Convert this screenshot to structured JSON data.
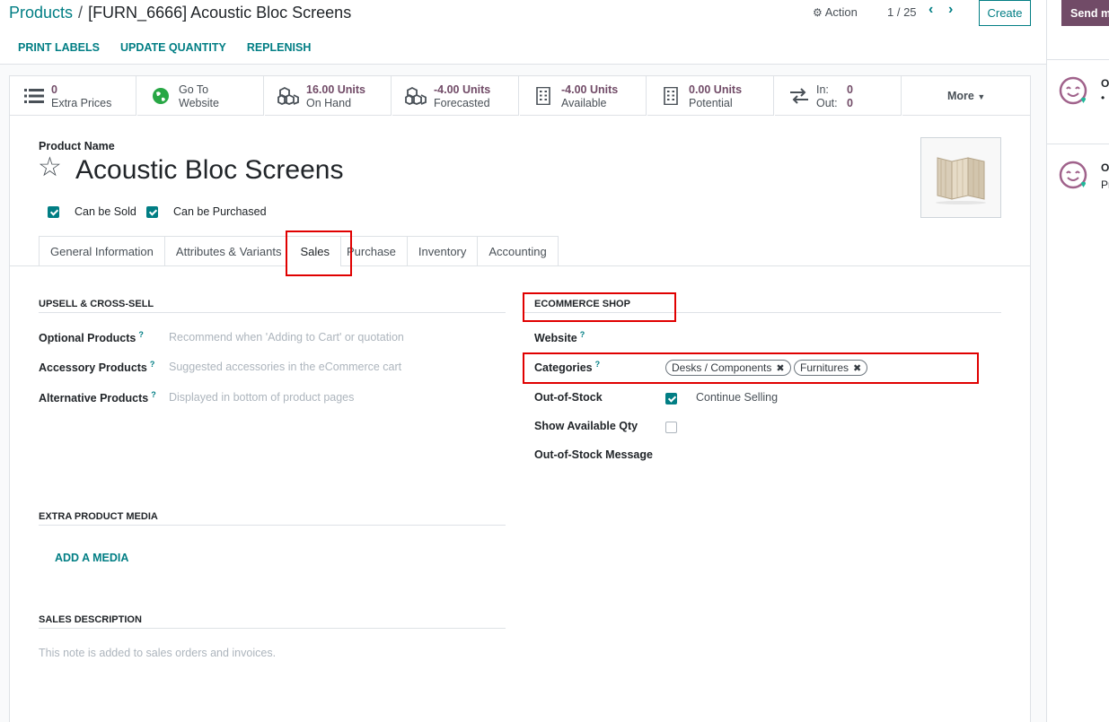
{
  "breadcrumb": {
    "parent": "Products",
    "separator": "/",
    "current": "[FURN_6666] Acoustic Bloc Screens"
  },
  "toolbar": {
    "action_label": "Action",
    "pager": "1 / 25",
    "create_label": "Create"
  },
  "sheet_buttons": [
    "PRINT LABELS",
    "UPDATE QUANTITY",
    "REPLENISH"
  ],
  "stats": [
    {
      "value": "0",
      "label": "Extra Prices",
      "icon": "list-icon"
    },
    {
      "value": "Go To",
      "label": "Website",
      "icon": "globe-icon"
    },
    {
      "value": "16.00 Units",
      "label": "On Hand",
      "icon": "cubes-icon"
    },
    {
      "value": "-4.00 Units",
      "label": "Forecasted",
      "icon": "cubes-icon"
    },
    {
      "value": "-4.00 Units",
      "label": "Available",
      "icon": "building-icon"
    },
    {
      "value": "0.00 Units",
      "label": "Potential",
      "icon": "building-icon"
    }
  ],
  "inout": {
    "in_label": "In:",
    "in_value": "0",
    "out_label": "Out:",
    "out_value": "0"
  },
  "more_label": "More",
  "product": {
    "name_label": "Product Name",
    "name": "Acoustic Bloc Screens",
    "can_be_sold": "Can be Sold",
    "can_be_purchased": "Can be Purchased"
  },
  "tabs": [
    "General Information",
    "Attributes & Variants",
    "Sales",
    "Purchase",
    "Inventory",
    "Accounting"
  ],
  "upsell": {
    "title": "UPSELL & CROSS-SELL",
    "optional_label": "Optional Products",
    "optional_placeholder": "Recommend when 'Adding to Cart' or quotation",
    "accessory_label": "Accessory Products",
    "accessory_placeholder": "Suggested accessories in the eCommerce cart",
    "alternative_label": "Alternative Products",
    "alternative_placeholder": "Displayed in bottom of product pages",
    "help_mark": "?"
  },
  "ecommerce": {
    "title": "ECOMMERCE SHOP",
    "website_label": "Website",
    "categories_label": "Categories",
    "categories": [
      "Desks / Components",
      "Furnitures"
    ],
    "out_of_stock_label": "Out-of-Stock",
    "continue_selling": "Continue Selling",
    "show_qty_label": "Show Available Qty",
    "oos_message_label": "Out-of-Stock Message"
  },
  "media": {
    "title": "EXTRA PRODUCT MEDIA",
    "add_label": "ADD A MEDIA"
  },
  "sales_desc": {
    "title": "SALES DESCRIPTION",
    "placeholder": "This note is added to sales orders and invoices."
  },
  "chatter": {
    "send_label": "Send m",
    "msg1_author": "Od",
    "msg1_text": "•",
    "msg2_author": "Od",
    "msg2_text": "Pr"
  },
  "colors": {
    "accent": "#017e84",
    "brand": "#714b67",
    "highlight": "#e00000"
  }
}
